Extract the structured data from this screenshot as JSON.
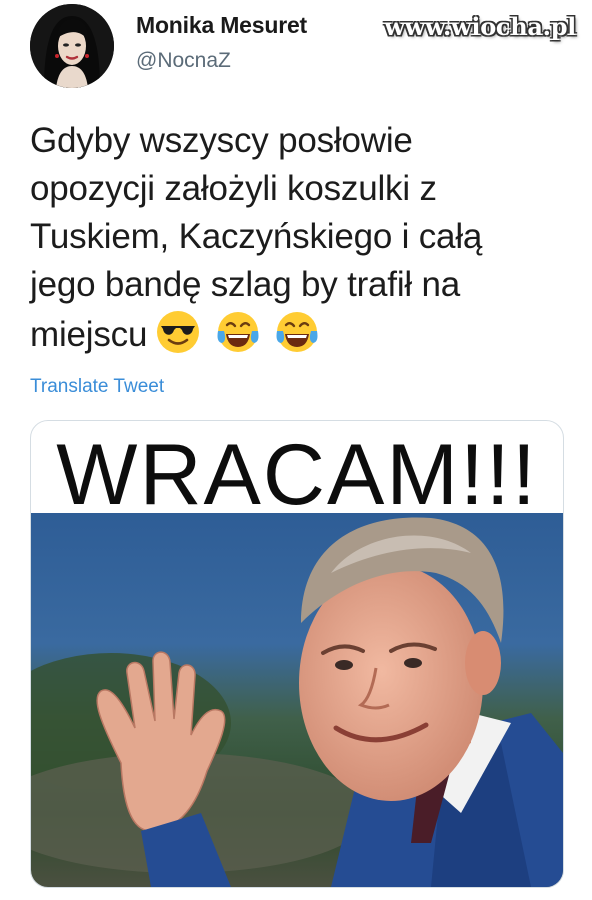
{
  "author": {
    "name": "Monika Mesuret",
    "handle": "@NocnaZ",
    "avatar_icon": "profile-photo"
  },
  "watermark": "www.wiocha.pl",
  "tweet": {
    "lines": [
      "Gdyby wszyscy posłowie",
      "opozycji założyli koszulki z",
      "Tuskiem, Kaczyńskiego i całą",
      "jego bandę szlag by trafił na",
      "miejscu"
    ],
    "emojis": [
      "smiling-face-with-sunglasses",
      "face-with-tears-of-joy",
      "face-with-tears-of-joy"
    ],
    "translate_label": "Translate Tweet"
  },
  "media": {
    "caption": "WRACAM!!!",
    "photo": "man-in-blue-suit-waving"
  },
  "colors": {
    "link": "#3a8dd8",
    "handle": "#5b6b78",
    "card_border": "#d5dde3"
  }
}
